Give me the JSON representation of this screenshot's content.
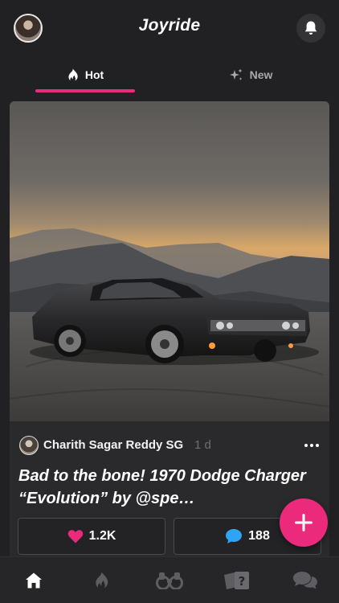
{
  "app": {
    "title": "Joyride"
  },
  "header": {
    "avatar_icon": "user-avatar",
    "notifications_icon": "bell-icon"
  },
  "tabs": [
    {
      "label": "Hot",
      "icon": "flame-icon",
      "active": true
    },
    {
      "label": "New",
      "icon": "sparkle-icon",
      "active": false
    }
  ],
  "post": {
    "image_icon": "car-photo",
    "author": "Charith Sagar Reddy SG",
    "age": "1 d",
    "title": "Bad to the bone! 1970 Dodge Charger “Evolution” by @spe…",
    "likes": "1.2K",
    "comments": "188"
  },
  "fab": {
    "icon": "plus-icon"
  },
  "bottom_nav": [
    {
      "icon": "home-icon",
      "active": true
    },
    {
      "icon": "flame-icon",
      "active": false
    },
    {
      "icon": "binoculars-icon",
      "active": false
    },
    {
      "icon": "question-cards-icon",
      "active": false
    },
    {
      "icon": "chat-bubbles-icon",
      "active": false
    }
  ],
  "colors": {
    "accent": "#ec2a7c",
    "background": "#212123",
    "card": "#2a2a2c",
    "comment_blue": "#2ea4f2",
    "muted_text": "#a8a8ad"
  }
}
